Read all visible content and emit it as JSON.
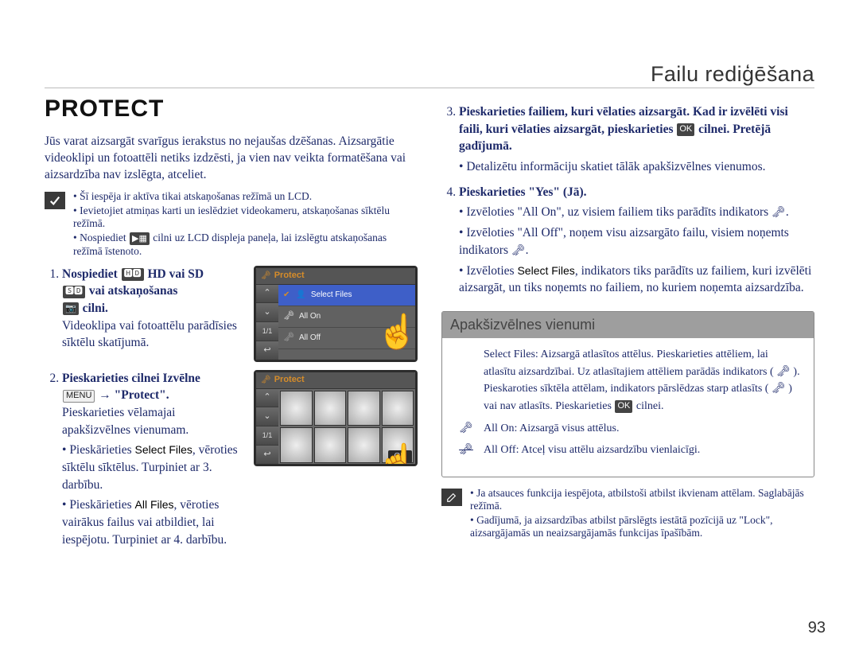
{
  "page": {
    "breadcrumb": "Failu rediģēšana",
    "page_number": "93"
  },
  "title": "PROTECT",
  "intro": "Jūs varat aizsargāt svarīgus ierakstus no nejaušas dzēšanas. Aizsargātie videoklipi un fotoattēli netiks izdzēsti, ja vien nav veikta formatēšana vai aizsardzība nav izslēgta, atceliet.",
  "left_notes": {
    "line1": "Šī iespēja ir aktīva tikai atskaņošanas režīmā un LCD.",
    "line2": "Ievietojiet atmiņas karti un ieslēdziet videokameru, atskaņošanas sīktēlu režīmā.",
    "line3": "Nospiediet",
    "line3_mid": " cilni uz LCD displeja paneļa, lai izslēgtu atskaņošanas režīmā īstenoto."
  },
  "steps_left": {
    "s1": {
      "bold": "Nospiediet",
      "rest_prefix": " HD vai SD",
      "line2": "vai atskaņošanas",
      "line3": "cilni.",
      "extra1": "Videoklipa vai fotoattēlu parādīsies sīktēlu skatījumā."
    },
    "s2": {
      "bold_line": "Pieskarieties cilnei Izvēlne",
      "menu_word": "MENU",
      "arrow": " → \"Protect\".",
      "extra0": "Pieskarieties vēlamajai apakšizvēlnes vienumam.",
      "b1_prefix": "Pieskārieties ",
      "b1_term": "Select Files",
      "b1_rest": ", vēroties sīktēlu sīktēlus. Turpiniet ar 3. darbību.",
      "b2_prefix": "Pieskārieties ",
      "b2_term": "All Files",
      "b2_rest": ", vēroties vairākus failus vai atbildiet, lai iespējotu. Turpiniet ar 4. darbību."
    }
  },
  "lcd1": {
    "title": "Protect",
    "item_sel": "Select Files",
    "item_on": "All On",
    "item_off": "All Off",
    "counter": "1/1"
  },
  "lcd2": {
    "title": "Protect",
    "counter": "1/1",
    "ok": "OK"
  },
  "steps_right": {
    "s3": {
      "bold1": "Pieskarieties failiem, kuri vēlaties aizsargāt. Kad ir izvēlēti visi faili, kuri vēlaties aizsargāt, pieskarieties",
      "ok_label": "OK",
      "bold2": "cilnei. Pretējā gadījumā.",
      "extra": "Detalizētu informāciju skatiet tālāk apakšizvēlnes vienumos."
    },
    "s4": {
      "bold": "Pieskarieties \"Yes\" (Jā).",
      "b1_prefix": "Izvēloties \"All On\", uz visiem failiem tiks parādīts indikators ",
      "b1_suffix": ".",
      "b2_prefix": "Izvēloties \"All Off\", noņem visu aizsargāto failu, visiem noņemts indikators ",
      "b2_suffix": ".",
      "b3_prefix": "Izvēloties ",
      "b3_term": "Select Files",
      "b3_rest": ", indikators tiks parādīts uz failiem, kuri izvēlēti aizsargāt, un tiks noņemts no failiem, no kuriem noņemta aizsardzība."
    }
  },
  "submenu": {
    "title": "Apakšizvēlnes vienumi",
    "r1": "Select Files: Aizsargā atlasītos attēlus. Pieskarieties attēliem, lai atlasītu aizsardzībai. Uz atlasītajiem attēliem parādās indikators ( 🗝 ). Pieskaroties sīktēla attēlam, indikators pārslēdzas starp atlasīts ( 🗝 ) vai nav atlasīts. Pieskarieties",
    "r1_after_ok": "cilnei.",
    "r2": "All On: Aizsargā visus attēlus.",
    "r3": "All Off: Atceļ visu attēlu aizsardzību vienlaicīgi."
  },
  "right_notes": {
    "line1": "Ja atsauces funkcija iespējota, atbilstoši atbilst ikvienam attēlam. Saglabājās režīmā.",
    "line2": "Gadījumā, ja aizsardzības atbilst pārslēgts iestātā pozīcijā uz \"Lock\", aizsargājamās un neaizsargājamās funkcijas īpašībām."
  }
}
